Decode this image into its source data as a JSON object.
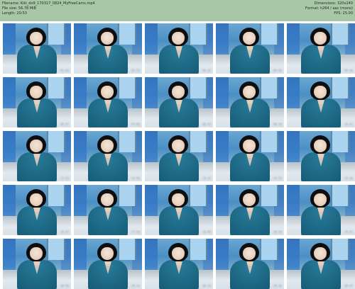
{
  "header": {
    "left": [
      "Filename: Kiki_do9_170317_0824_MyFreeCams.mp4",
      "File size: 56.78 MiB",
      "Length: 20:53"
    ],
    "right": [
      "Dimensions: 320x240",
      "Format: h264 / aac (mono)",
      "FPS: 25.00"
    ]
  },
  "thumbnails": [
    {
      "timestamp": "01:02"
    },
    {
      "timestamp": "02:13"
    },
    {
      "timestamp": "03:24"
    },
    {
      "timestamp": "04:35"
    },
    {
      "timestamp": "05:46"
    },
    {
      "timestamp": "06:57"
    },
    {
      "timestamp": "07:08"
    },
    {
      "timestamp": "08:19"
    },
    {
      "timestamp": "09:30"
    },
    {
      "timestamp": "10:41"
    },
    {
      "timestamp": "11:52"
    },
    {
      "timestamp": "12:03"
    },
    {
      "timestamp": "13:14"
    },
    {
      "timestamp": "14:25"
    },
    {
      "timestamp": "15:36"
    },
    {
      "timestamp": "16:47"
    },
    {
      "timestamp": "17:58"
    },
    {
      "timestamp": "18:09"
    },
    {
      "timestamp": "19:20"
    },
    {
      "timestamp": "19:52"
    },
    {
      "timestamp": "20:03"
    },
    {
      "timestamp": "20:14"
    },
    {
      "timestamp": "20:25"
    },
    {
      "timestamp": "20:36"
    },
    {
      "timestamp": "20:47"
    }
  ]
}
